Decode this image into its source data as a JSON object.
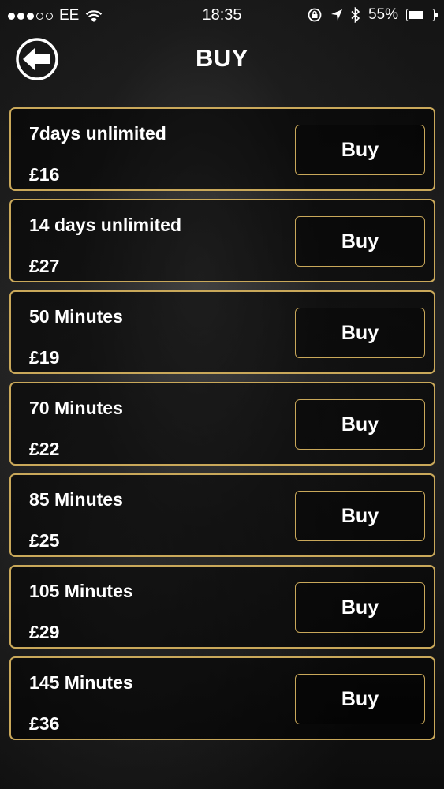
{
  "status_bar": {
    "carrier": "EE",
    "time": "18:35",
    "battery_percent": "55%",
    "battery_level": 0.55,
    "signal_bars_filled": 3,
    "signal_bars_total": 5
  },
  "header": {
    "title": "BUY",
    "back_icon": "back-arrow-icon"
  },
  "colors": {
    "accent_gold": "#c9a85a",
    "text": "#ffffff"
  },
  "plans": [
    {
      "name": "7days unlimited",
      "price": "£16",
      "button_label": "Buy"
    },
    {
      "name": "14 days unlimited",
      "price": "£27",
      "button_label": "Buy"
    },
    {
      "name": "50 Minutes",
      "price": "£19",
      "button_label": "Buy"
    },
    {
      "name": "70 Minutes",
      "price": "£22",
      "button_label": "Buy"
    },
    {
      "name": "85 Minutes",
      "price": "£25",
      "button_label": "Buy"
    },
    {
      "name": "105 Minutes",
      "price": "£29",
      "button_label": "Buy"
    },
    {
      "name": "145 Minutes",
      "price": "£36",
      "button_label": "Buy"
    }
  ]
}
